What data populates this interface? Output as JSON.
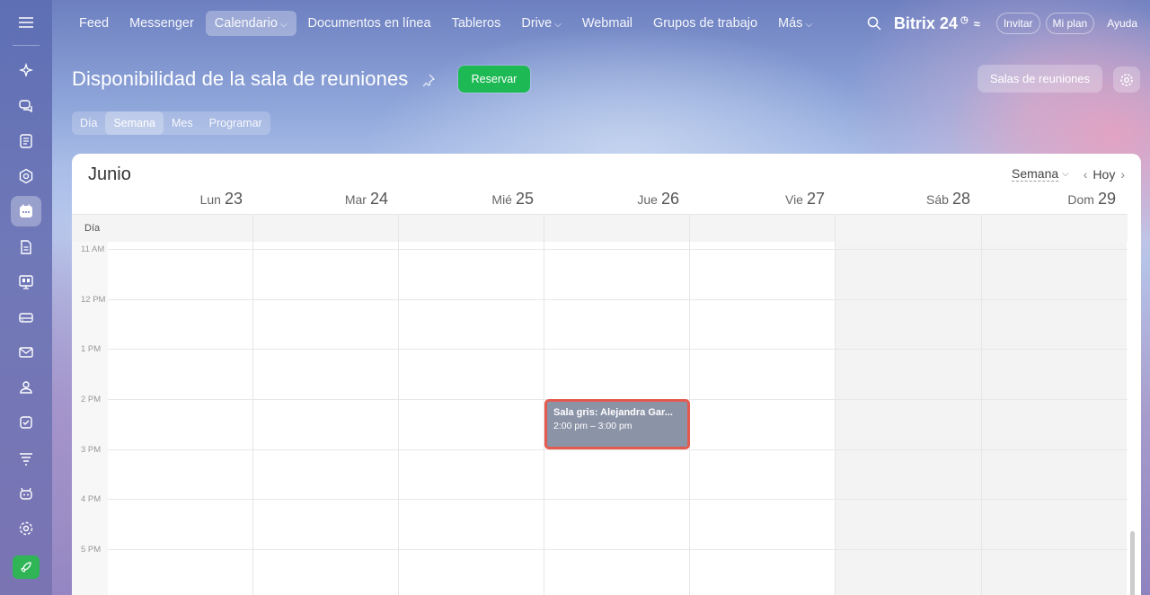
{
  "sidebar": {
    "items": [
      {
        "icon": "sparkle-icon",
        "active": false
      },
      {
        "icon": "chat-icon",
        "active": false
      },
      {
        "icon": "feed-icon",
        "active": false
      },
      {
        "icon": "hexagon-icon",
        "active": false
      },
      {
        "icon": "calendar-icon",
        "active": true
      },
      {
        "icon": "document-icon",
        "active": false
      },
      {
        "icon": "board-icon",
        "active": false
      },
      {
        "icon": "drive-icon",
        "active": false
      },
      {
        "icon": "mail-icon",
        "active": false
      },
      {
        "icon": "users-icon",
        "active": false
      },
      {
        "icon": "tasks-icon",
        "active": false
      },
      {
        "icon": "filter-icon",
        "active": false
      },
      {
        "icon": "robot-icon",
        "active": false
      },
      {
        "icon": "settings-icon",
        "active": false
      }
    ]
  },
  "nav": {
    "items": [
      "Feed",
      "Messenger",
      "Calendario",
      "Documentos en línea",
      "Tableros",
      "Drive",
      "Webmail",
      "Grupos de trabajo",
      "Más"
    ],
    "active": "Calendario"
  },
  "top": {
    "brand": "Bitrix 24",
    "invite": "Invitar",
    "plan": "Mi plan",
    "help": "Ayuda"
  },
  "page": {
    "title": "Disponibilidad de la sala de reuniones",
    "reserve": "Reservar",
    "rooms": "Salas de reuniones"
  },
  "view_tabs": [
    "Día",
    "Semana",
    "Mes",
    "Programar"
  ],
  "active_view": "Semana",
  "calendar": {
    "month": "Junio",
    "view_select": "Semana",
    "today": "Hoy",
    "days": [
      {
        "name": "Lun",
        "num": "23"
      },
      {
        "name": "Mar",
        "num": "24"
      },
      {
        "name": "Mié",
        "num": "25"
      },
      {
        "name": "Jue",
        "num": "26"
      },
      {
        "name": "Vie",
        "num": "27"
      },
      {
        "name": "Sáb",
        "num": "28"
      },
      {
        "name": "Dom",
        "num": "29"
      }
    ],
    "allday_label": "Día",
    "hours": [
      "11 AM",
      "12 PM",
      "1 PM",
      "2 PM",
      "3 PM",
      "4 PM",
      "5 PM"
    ],
    "event": {
      "title": "Sala gris: Alejandra Gar...",
      "time": "2:00 pm – 3:00 pm",
      "color": "#8b93a7",
      "highlight": "#e45a4f"
    }
  },
  "colors": {
    "accent_green": "#1db954",
    "sidebar": "#6f78b8"
  }
}
